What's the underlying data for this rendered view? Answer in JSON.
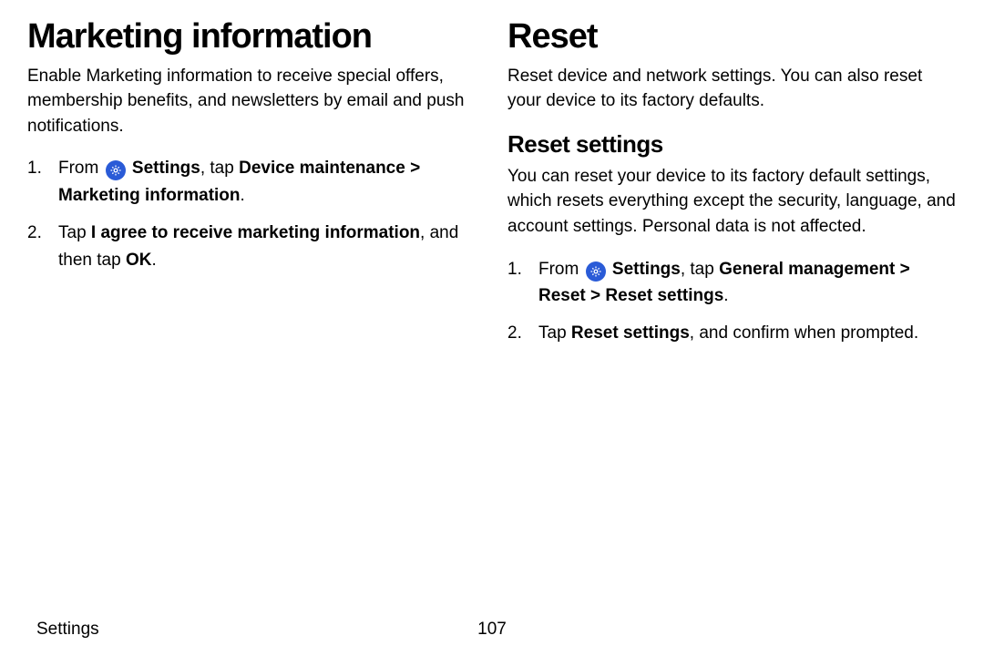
{
  "left": {
    "heading": "Marketing information",
    "intro": "Enable Marketing information to receive special offers, membership benefits, and newsletters by email and push notifications.",
    "steps": {
      "s1_from": "From",
      "s1_settings": "Settings",
      "s1_tap": ", tap",
      "s1_dm": "Device maintenance",
      "s1_sep": ">",
      "s1_mi": "Marketing information",
      "s1_dot": ".",
      "s2_tap": "Tap",
      "s2_agree": "I agree to receive marketing information",
      "s2_and": ", and then tap",
      "s2_ok": "OK",
      "s2_dot": "."
    }
  },
  "right": {
    "heading": "Reset",
    "intro": "Reset device and network settings. You can also reset your device to its factory defaults.",
    "sub": "Reset settings",
    "subintro": "You can reset your device to its factory default settings, which resets everything except the security, language, and account settings. Personal data is not affected.",
    "steps": {
      "s1_from": "From",
      "s1_settings": "Settings",
      "s1_tap": ", tap",
      "s1_gm": "General management",
      "s1_sep1": ">",
      "s1_reset": "Reset",
      "s1_sep2": ">",
      "s1_rs": "Reset settings",
      "s1_dot": ".",
      "s2_tap": "Tap",
      "s2_rs": "Reset settings",
      "s2_rest": ", and confirm when prompted."
    }
  },
  "footer": {
    "section": "Settings",
    "page": "107"
  }
}
